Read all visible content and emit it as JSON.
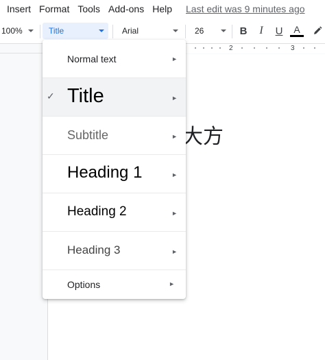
{
  "menubar": {
    "items": [
      "Insert",
      "Format",
      "Tools",
      "Add-ons",
      "Help"
    ],
    "last_edit": "Last edit was 9 minutes ago"
  },
  "toolbar": {
    "zoom": "100%",
    "style": "Title",
    "font": "Arial",
    "font_size": "26",
    "bold": "B",
    "italic": "I",
    "underline": "U",
    "text_color": "A",
    "text_color_value": "#000000",
    "highlight_icon": "pencil-icon"
  },
  "ruler": {
    "numbers": [
      "2",
      "3"
    ]
  },
  "document": {
    "visible_text": "大方"
  },
  "styles_menu": {
    "items": [
      {
        "label": "Normal text",
        "selected": false
      },
      {
        "label": "Title",
        "selected": true
      },
      {
        "label": "Subtitle",
        "selected": false
      },
      {
        "label": "Heading 1",
        "selected": false
      },
      {
        "label": "Heading 2",
        "selected": false
      },
      {
        "label": "Heading 3",
        "selected": false
      },
      {
        "label": "Options",
        "selected": false
      }
    ],
    "check_glyph": "✓",
    "arrow_glyph": "►"
  },
  "colors": {
    "accent": "#1a73e8",
    "selected_bg": "#f1f3f4",
    "style_box_bg": "#e8f0fe"
  }
}
